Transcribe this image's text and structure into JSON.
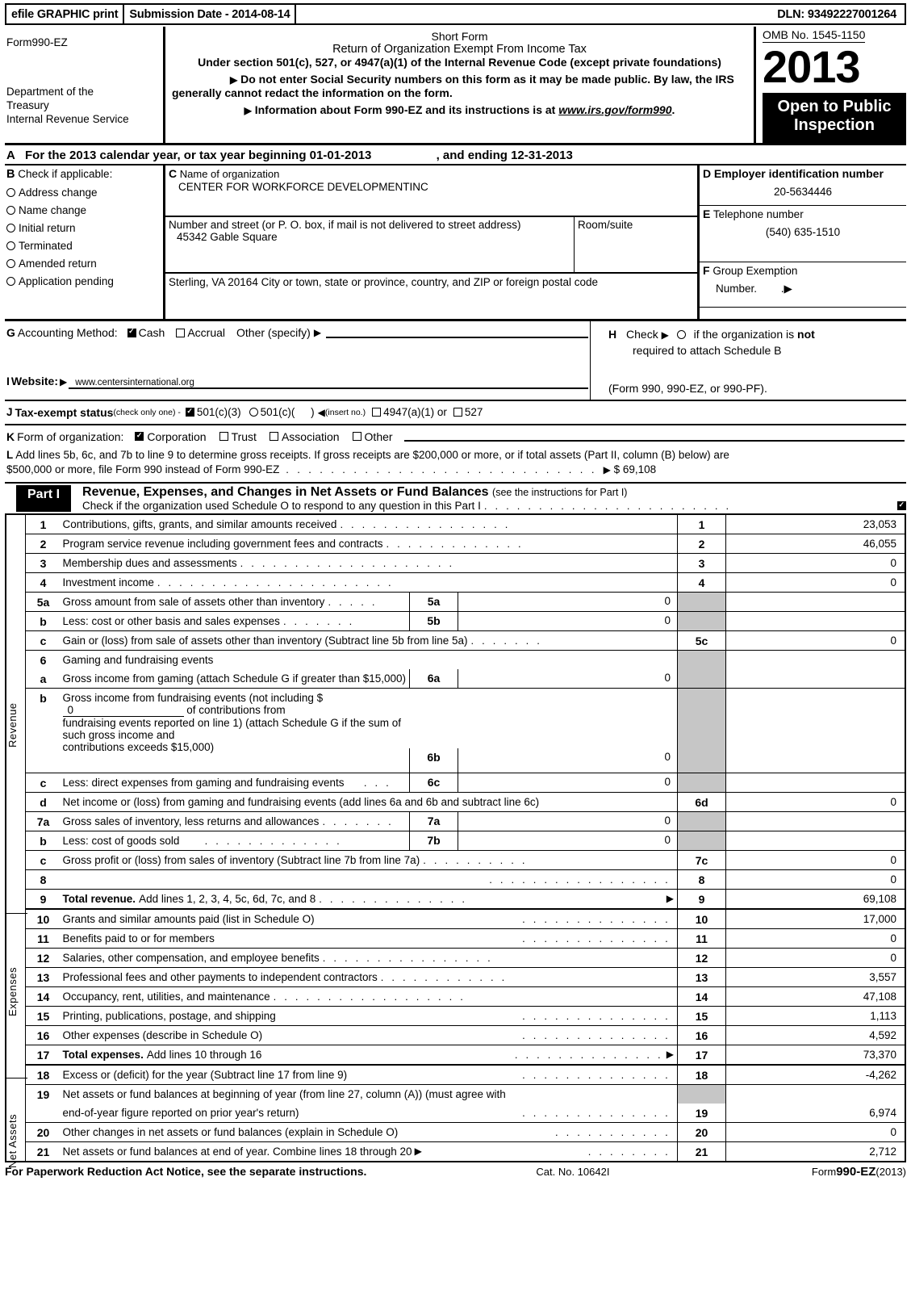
{
  "efile": {
    "graphic_print": "efile GRAPHIC print",
    "submission_date": "Submission Date - 2014-08-14",
    "dln": "DLN: 93492227001264"
  },
  "masthead": {
    "form_number": "Form990-EZ",
    "department": "Department of the Treasury",
    "agency": "Internal Revenue Service",
    "short_form": "Short Form",
    "title": "Return of Organization Exempt From Income Tax",
    "subtitle": "Under section 501(c), 527, or 4947(a)(1) of the Internal Revenue Code (except private foundations)",
    "note1": "Do not enter Social Security numbers on this form as it may be made public. By law, the IRS generally cannot redact the information on the form.",
    "note2_prefix": "Information about Form 990-EZ and its instructions is at ",
    "note2_link": "www.irs.gov/form990",
    "note2_suffix": ".",
    "omb": "OMB No. 1545-1150",
    "year": "2013",
    "open_to_public": "Open to Public Inspection"
  },
  "sectionA": {
    "letter": "A",
    "text": "For the 2013 calendar year, or tax year beginning",
    "begin_date": "01-01-2013",
    "ending_label": ", and ending",
    "end_date": "12-31-2013"
  },
  "sectionB": {
    "letter": "B",
    "header": "Check if applicable:",
    "items": [
      {
        "label": "Address change",
        "checked": false
      },
      {
        "label": "Name change",
        "checked": false
      },
      {
        "label": "Initial return",
        "checked": false
      },
      {
        "label": "Terminated",
        "checked": false
      },
      {
        "label": "Amended return",
        "checked": false
      },
      {
        "label": "Application pending",
        "checked": false
      }
    ]
  },
  "sectionC": {
    "letter": "C",
    "name_label": "Name of organization",
    "name_value": "CENTER FOR WORKFORCE DEVELOPMENTINC",
    "street_label": "Number and street (or P. O. box, if mail is not delivered to street address)",
    "street_value": "45342 Gable Square",
    "room_label": "Room/suite",
    "room_value": "",
    "city_line": "Sterling, VA   20164 City or town, state or province, country, and ZIP or foreign postal code"
  },
  "sectionD": {
    "letter": "D",
    "label": "Employer identification number",
    "value": "20-5634446"
  },
  "sectionE": {
    "letter": "E",
    "label": "Telephone number",
    "value": "(540) 635-1510"
  },
  "sectionF": {
    "letter": "F",
    "label_line1": "Group Exemption",
    "label_line2": "Number.",
    "value": ""
  },
  "sectionG": {
    "letter": "G",
    "label": "Accounting Method:",
    "cash": "Cash",
    "cash_checked": true,
    "accrual": "Accrual",
    "accrual_checked": false,
    "other": "Other (specify)",
    "other_value": ""
  },
  "sectionH": {
    "letter": "H",
    "line1_a": "Check",
    "line1_b": "if the organization is ",
    "line1_bold": "not",
    "line2": "required to attach Schedule B",
    "line3": "(Form 990, 990-EZ, or 990-PF).",
    "checked": false
  },
  "sectionI": {
    "letter": "I",
    "label": "Website:",
    "value": "www.centersinternational.org"
  },
  "sectionJ": {
    "letter": "J",
    "label": "Tax-exempt status",
    "hint": "(check only one) -",
    "opt1": "501(c)(3)",
    "opt1_checked": true,
    "opt2": "501(c)(",
    "opt2_checked": false,
    "opt2_suffix": ")",
    "insert_no": "(insert no.)",
    "opt3": "4947(a)(1) or",
    "opt3_checked": false,
    "opt4": "527",
    "opt4_checked": false
  },
  "sectionK": {
    "letter": "K",
    "label": "Form of organization:",
    "options": [
      {
        "label": "Corporation",
        "checked": true
      },
      {
        "label": "Trust",
        "checked": false
      },
      {
        "label": "Association",
        "checked": false
      },
      {
        "label": "Other",
        "checked": false
      }
    ]
  },
  "sectionL": {
    "letter": "L",
    "text_line1": "Add lines 5b, 6c, and 7b to line 9 to determine gross receipts. If gross receipts are $200,000 or more, or if total assets (Part II, column (B) below) are",
    "text_line2": "$500,000 or more, file Form 990 instead of Form 990-EZ",
    "amount_prefix": "$",
    "amount": "69,108"
  },
  "partI": {
    "tag": "Part I",
    "title": "Revenue, Expenses, and Changes in Net Assets or Fund Balances",
    "title_note": "(see the instructions for Part I)",
    "schedule_o_check": "Check if the organization used Schedule O to respond to any question in this Part I",
    "schedule_o_checked": true
  },
  "vertical_labels": {
    "revenue": "Revenue",
    "expenses": "Expenses",
    "net_assets": "Net Assets"
  },
  "table": {
    "revenue_rows": [
      {
        "num": "1",
        "desc": "Contributions, gifts, grants, and similar amounts received",
        "key": "1",
        "amount": "23,053",
        "dots": true
      },
      {
        "num": "2",
        "desc": "Program service revenue including government fees and contracts",
        "key": "2",
        "amount": "46,055",
        "dots": true
      },
      {
        "num": "3",
        "desc": "Membership dues and assessments",
        "key": "3",
        "amount": "0",
        "dots": true
      },
      {
        "num": "4",
        "desc": "Investment income",
        "key": "4",
        "amount": "0",
        "dots": true
      },
      {
        "num": "5a",
        "desc": "Gross amount from sale of assets other than inventory",
        "sub_key": "5a",
        "sub_value": "0",
        "key": "",
        "key_gray": true,
        "amount": "",
        "dots": true
      },
      {
        "num": "b",
        "desc": "Less: cost or other basis and sales expenses",
        "sub_key": "5b",
        "sub_value": "0",
        "key": "",
        "key_gray": true,
        "amount": "",
        "dots": true
      },
      {
        "num": "c",
        "desc": "Gain or (loss) from sale of assets other than inventory (Subtract line 5b from line 5a)",
        "key": "5c",
        "amount": "0",
        "dots": true
      },
      {
        "num": "6",
        "desc": "Gaming and fundraising events",
        "key": "",
        "key_gray": true,
        "amount": "",
        "dots": false
      },
      {
        "num": "a",
        "desc": "Gross income from gaming (attach Schedule G if greater than $15,000)",
        "sub_key": "6a",
        "sub_value": "0",
        "key": "",
        "key_gray": true,
        "amount": "",
        "dots": false
      }
    ],
    "row6b": {
      "num": "b",
      "text_a": "Gross income from fundraising events (not including $",
      "inline_value": "0",
      "text_b": "of contributions from",
      "line2": "fundraising events reported on line 1) (attach Schedule G if the sum of such gross income and",
      "line3": "contributions exceeds $15,000)",
      "sub_key": "6b",
      "sub_value": "0"
    },
    "row6c": {
      "num": "c",
      "desc": "Less: direct expenses from gaming and fundraising events",
      "sub_key": "6c",
      "sub_value": "0"
    },
    "row6d": {
      "num": "d",
      "desc": "Net income or (loss) from gaming and fundraising events (add lines 6a and 6b and subtract line 6c)",
      "key": "6d",
      "amount": "0"
    },
    "rows_7_9": [
      {
        "num": "7a",
        "desc": "Gross sales of inventory, less returns and allowances",
        "sub_key": "7a",
        "sub_value": "0",
        "key": "",
        "key_gray": true,
        "amount": "",
        "dots": true
      },
      {
        "num": "b",
        "desc": "Less: cost of goods sold",
        "sub_key": "7b",
        "sub_value": "0",
        "key": "",
        "key_gray": true,
        "amount": "",
        "dots": true
      },
      {
        "num": "c",
        "desc": "Gross profit or (loss) from sales of inventory (Subtract line 7b from line 7a)",
        "key": "7c",
        "amount": "0",
        "dots": true
      },
      {
        "num": "8",
        "desc": "",
        "key": "8",
        "amount": "0",
        "dots": true
      },
      {
        "num": "9",
        "desc_bold": "Total revenue.",
        "desc": "Add lines 1, 2, 3, 4, 5c, 6d, 7c, and 8",
        "key": "9",
        "amount": "69,108",
        "dots": true,
        "arrow": true
      }
    ],
    "expense_rows": [
      {
        "num": "10",
        "desc": "Grants and similar amounts paid (list in Schedule O)",
        "key": "10",
        "amount": "17,000",
        "dots": true
      },
      {
        "num": "11",
        "desc": "Benefits paid to or for members",
        "key": "11",
        "amount": "0",
        "dots": true
      },
      {
        "num": "12",
        "desc": "Salaries, other compensation, and employee benefits",
        "key": "12",
        "amount": "0",
        "dots": true
      },
      {
        "num": "13",
        "desc": "Professional fees and other payments to independent contractors",
        "key": "13",
        "amount": "3,557",
        "dots": true
      },
      {
        "num": "14",
        "desc": "Occupancy, rent, utilities, and maintenance",
        "key": "14",
        "amount": "47,108",
        "dots": true
      },
      {
        "num": "15",
        "desc": "Printing, publications, postage, and shipping",
        "key": "15",
        "amount": "1,113",
        "dots": true
      },
      {
        "num": "16",
        "desc": "Other expenses (describe in Schedule O)",
        "key": "16",
        "amount": "4,592",
        "dots": true
      },
      {
        "num": "17",
        "desc_bold": "Total expenses.",
        "desc": "Add lines 10 through 16",
        "key": "17",
        "amount": "73,370",
        "dots": true,
        "arrow": true
      }
    ],
    "net_asset_rows": [
      {
        "num": "18",
        "desc": "Excess or (deficit) for the year (Subtract line 17 from line 9)",
        "key": "18",
        "amount": "-4,262",
        "dots": true
      },
      {
        "num": "19",
        "desc": "Net assets or fund balances at beginning of year (from line 27, column (A)) (must agree with",
        "desc2": "end-of-year figure reported on prior year's return)",
        "key": "19",
        "amount": "6,974",
        "dots": true
      },
      {
        "num": "20",
        "desc": "Other changes in net assets or fund balances (explain in Schedule O)",
        "key": "20",
        "amount": "0",
        "dots": true
      },
      {
        "num": "21",
        "desc": "Net assets or fund balances at end of year. Combine lines 18 through 20",
        "key": "21",
        "amount": "2,712",
        "dots": true,
        "arrow_inline": true
      }
    ]
  },
  "footer": {
    "paperwork": "For Paperwork Reduction Act Notice, see the separate instructions.",
    "cat_no": "Cat. No. 10642I",
    "form_prefix": "Form",
    "form_bold": "990-EZ",
    "form_year": "(2013)"
  }
}
